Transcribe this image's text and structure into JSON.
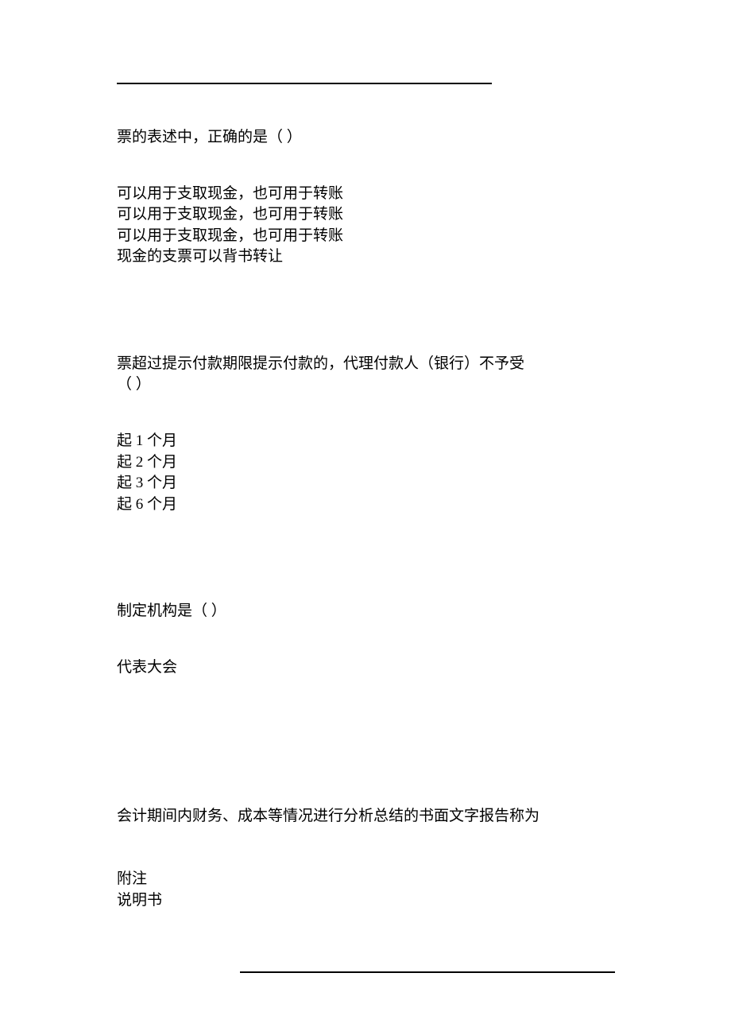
{
  "q1": {
    "stem": "票的表述中，正确的是（ ）",
    "opts": [
      "﻿可以用于支取现金，也可用于转账",
      "﻿可以用于支取现金，也可用于转账",
      "﻿可以用于支取现金，也可用于转账",
      "﻿现金的支票可以背书转让"
    ]
  },
  "q2": {
    "tag": "﻿",
    "stem1": "﻿票超过提示付款期限提示付款的，代理付款人（银行）不予受",
    "stem2": "（ ）",
    "opts": [
      "﻿起 1 个月",
      "﻿起 2 个月",
      "﻿起 3 个月",
      "﻿起 6 个月"
    ]
  },
  "q3": {
    "tag": "﻿",
    "stem": "﻿制定机构是（ ）",
    "opts": [
      "﻿代表大会",
      "",
      "﻿",
      "﻿"
    ]
  },
  "q4": {
    "tag": "﻿",
    "stem": "会计期间内财务、成本等情况进行分析总结的书面文字报告称为",
    "opts": [
      "﻿",
      "﻿附注",
      "﻿说明书"
    ]
  }
}
